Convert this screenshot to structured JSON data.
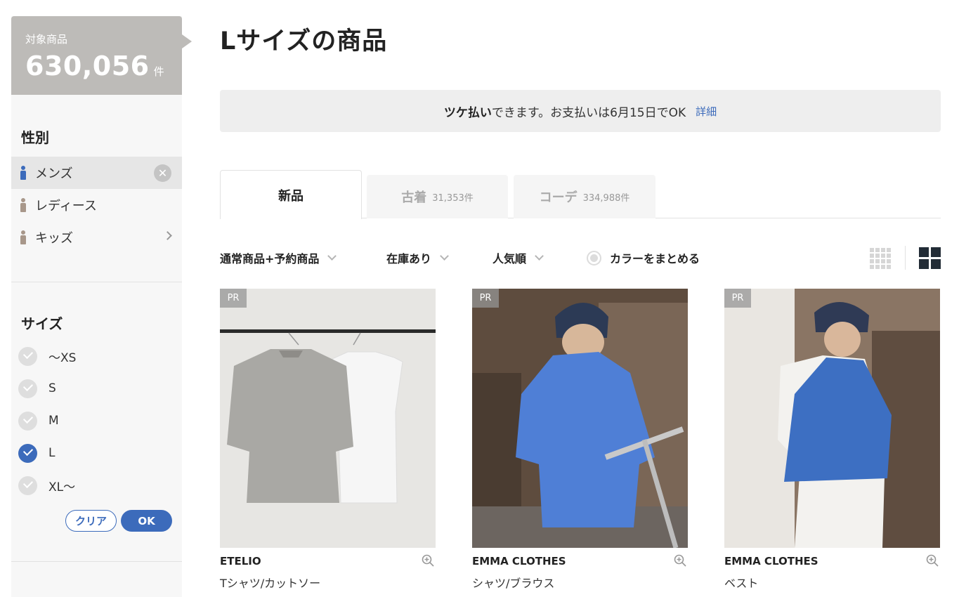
{
  "sidebar": {
    "count_label": "対象商品",
    "count_value": "630,056",
    "count_unit": "件",
    "gender": {
      "title": "性別",
      "items": [
        {
          "label": "メンズ",
          "icon": "person-icon",
          "selected": true
        },
        {
          "label": "レディース",
          "icon": "person-icon",
          "selected": false
        },
        {
          "label": "キッズ",
          "icon": "person-icon",
          "selected": false
        }
      ],
      "clear_glyph": "✕"
    },
    "size": {
      "title": "サイズ",
      "items": [
        {
          "label": "〜XS",
          "checked": false
        },
        {
          "label": "S",
          "checked": false
        },
        {
          "label": "M",
          "checked": false
        },
        {
          "label": "L",
          "checked": true
        },
        {
          "label": "XL〜",
          "checked": false
        }
      ],
      "clear_label": "クリア",
      "ok_label": "OK"
    }
  },
  "main": {
    "title": "Lサイズの商品",
    "banner": {
      "bold": "ツケ払い",
      "text": "できます。お支払いは6月15日でOK",
      "link": "詳細"
    },
    "tabs": [
      {
        "label": "新品",
        "count": ""
      },
      {
        "label": "古着",
        "count": "31,353件"
      },
      {
        "label": "コーデ",
        "count": "334,988件"
      }
    ],
    "filters": {
      "type": "通常商品+予約商品",
      "stock": "在庫あり",
      "sort": "人気順",
      "color_toggle": "カラーをまとめる"
    },
    "products": [
      {
        "badge": "PR",
        "brand": "ETELIO",
        "category": "Tシャツ/カットソー"
      },
      {
        "badge": "PR",
        "brand": "EMMA CLOTHES",
        "category": "シャツ/ブラウス"
      },
      {
        "badge": "PR",
        "brand": "EMMA CLOTHES",
        "category": "ベスト"
      }
    ]
  },
  "colors": {
    "accent": "#3c6bbb",
    "count_box": "#bdbbb8",
    "dark": "#222c36"
  }
}
